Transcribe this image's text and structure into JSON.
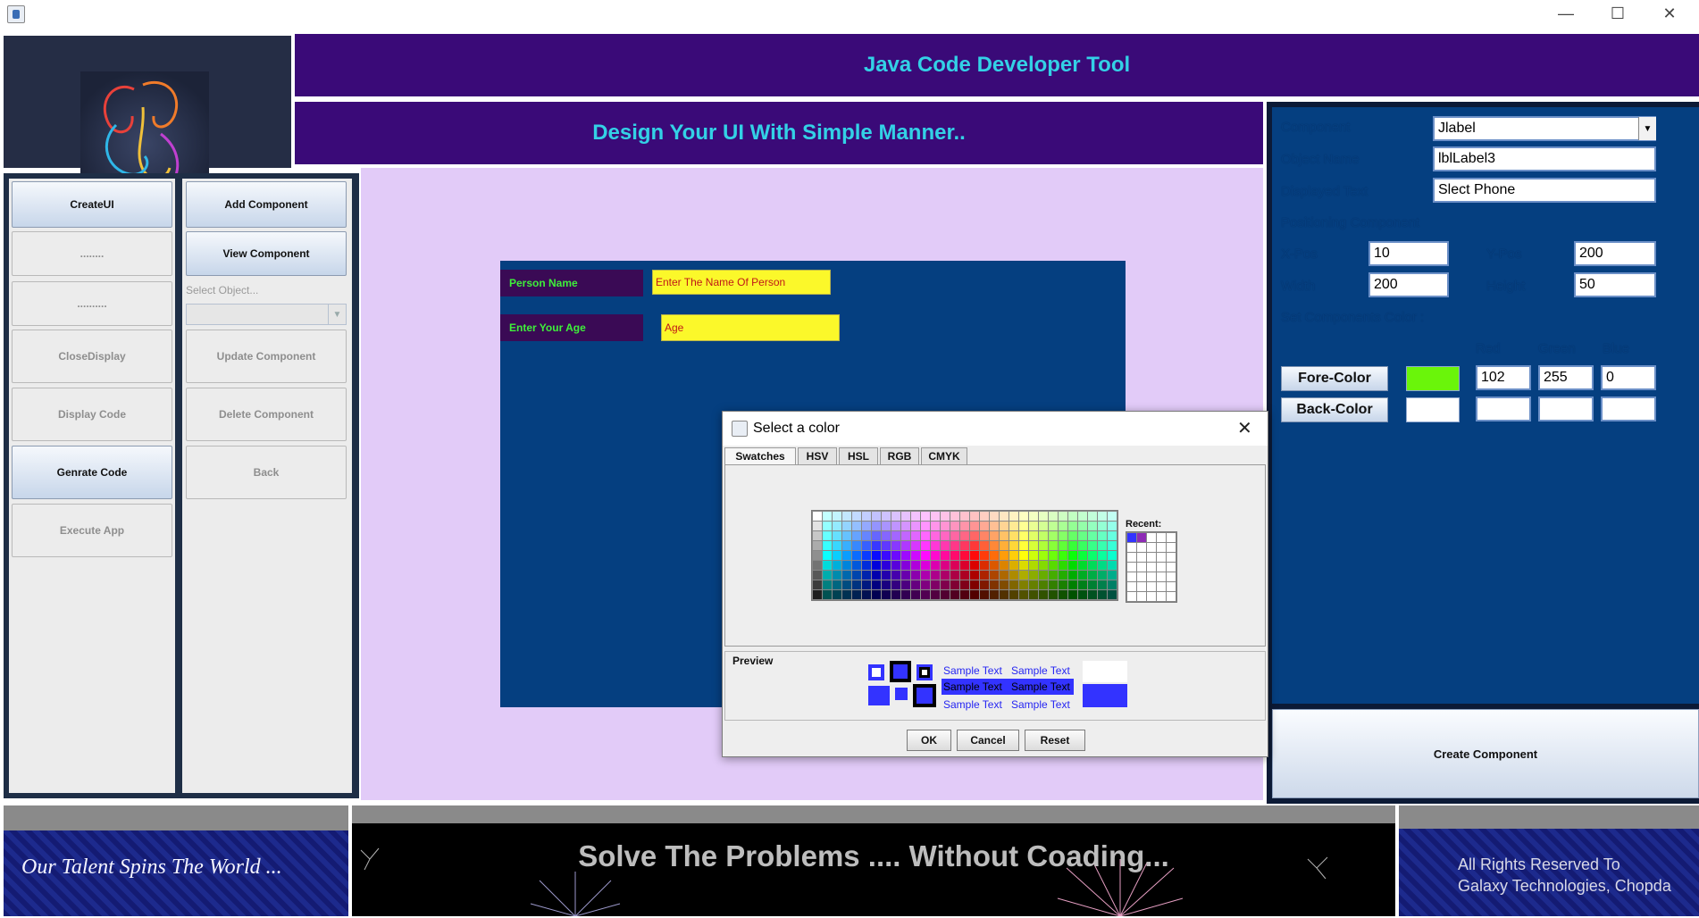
{
  "window": {
    "minimize": "—",
    "maximize": "☐",
    "close": "✕"
  },
  "header": {
    "title": "Java Code Developer Tool",
    "subtitle": "Design Your UI With Simple Manner.."
  },
  "left_buttons": {
    "col1": [
      "CreateUI",
      "........",
      "..........",
      "CloseDisplay",
      "Display Code",
      "Genrate Code",
      "Execute App"
    ],
    "col2": [
      "Add Component",
      "View Component",
      "Update Component",
      "Delete Component",
      "Back"
    ],
    "select_object_label": "Select Object...",
    "select_object_value": ""
  },
  "canvas": {
    "label1": "Person Name",
    "text1": "Enter The Name Of Person",
    "label2": "Enter Your Age",
    "text2": "Age"
  },
  "properties": {
    "component_label": "Component",
    "component_value": "Jlabel",
    "object_name_label": "Object Name",
    "object_name_value": "lblLabel3",
    "displayed_text_label": "Displayed Text",
    "displayed_text_value": "Slect Phone",
    "positioning_label": "Positioning Component",
    "xpos_label": "X-Pos",
    "xpos_value": "10",
    "ypos_label": "Y-Pos",
    "ypos_value": "200",
    "width_label": "Width",
    "width_value": "200",
    "height_label": "Height",
    "height_value": "50",
    "color_section_label": "Set Components Color :",
    "red_label": "Red",
    "green_label": "Green",
    "blue_label": "Blue",
    "fore_button": "Fore-Color",
    "fore_swatch": "#6af50a",
    "fore_red": "102",
    "fore_green": "255",
    "fore_blue": "0",
    "back_button": "Back-Color",
    "back_red": "",
    "back_green": "",
    "back_blue": "",
    "create_button": "Create Component"
  },
  "footer": {
    "left": "Our Talent Spins The World ...",
    "middle": "Solve The Problems .... Without Coading...",
    "right_line1": "All Rights Reserved To",
    "right_line2": "Galaxy Technologies, Chopda"
  },
  "dialog": {
    "title": "Select a color",
    "tabs": [
      "Swatches",
      "HSV",
      "HSL",
      "RGB",
      "CMYK"
    ],
    "active_tab": "Swatches",
    "recent_label": "Recent:",
    "preview_label": "Preview",
    "sample_text": "Sample Text",
    "selected_color": "#3333ff",
    "ok": "OK",
    "cancel": "Cancel",
    "reset": "Reset"
  },
  "colors": {
    "header_bg": "#3a0a78",
    "header_text": "#33d1e6",
    "canvas_bg": "#053f80",
    "design_bg": "#e2cbf8",
    "label_green": "#3ef03a",
    "field_yellow": "#fbf82a"
  }
}
